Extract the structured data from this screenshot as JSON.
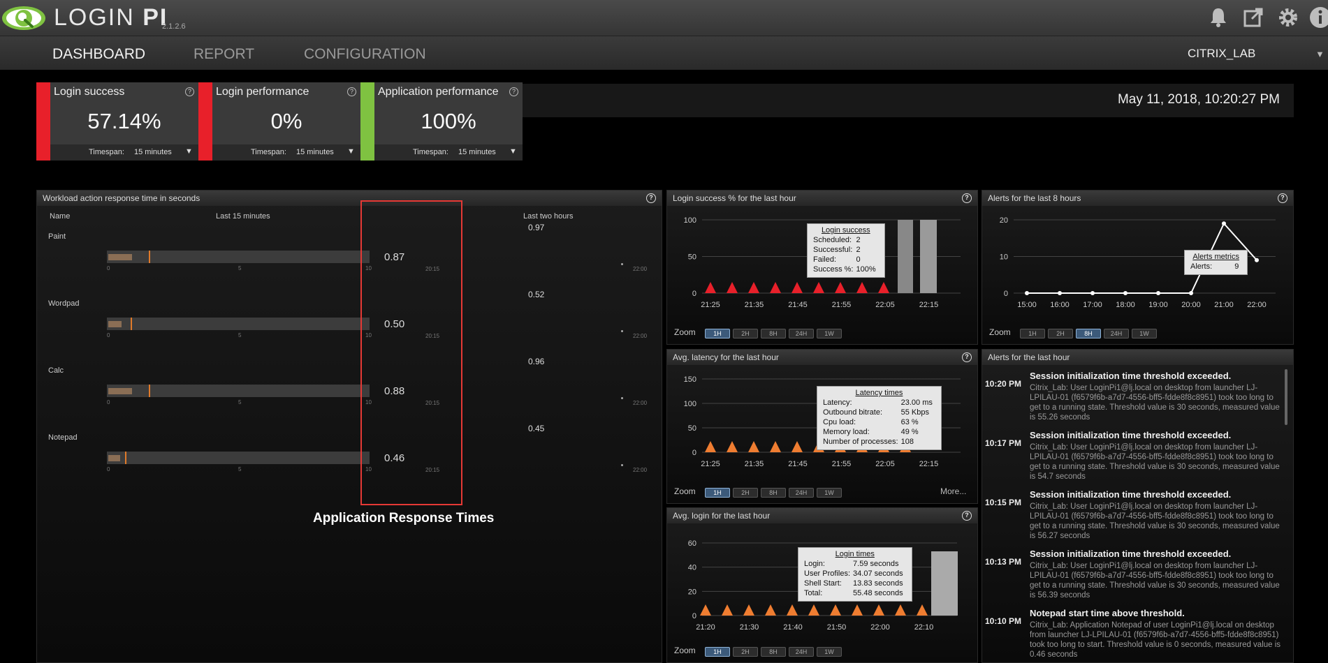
{
  "app": {
    "name_light": "LOGIN ",
    "name_bold": "PI",
    "version": "2.1.2.6"
  },
  "nav": {
    "tabs": [
      {
        "label": "DASHBOARD",
        "active": true
      },
      {
        "label": "REPORT",
        "active": false
      },
      {
        "label": "CONFIGURATION",
        "active": false
      }
    ],
    "environment": "CITRIX_LAB"
  },
  "kpis": [
    {
      "title": "Login success",
      "value": "57.14%",
      "status_color": "#e8202a",
      "timespan_label": "Timespan:",
      "timespan": "15 minutes"
    },
    {
      "title": "Login performance",
      "value": "0%",
      "status_color": "#e8202a",
      "timespan_label": "Timespan:",
      "timespan": "15 minutes"
    },
    {
      "title": "Application performance",
      "value": "100%",
      "status_color": "#7fc241",
      "timespan_label": "Timespan:",
      "timespan": "15 minutes"
    }
  ],
  "datetime": "May 11, 2018, 10:20:27 PM",
  "workload": {
    "title": "Workload action response time in seconds",
    "col_name": "Name",
    "col_last15": "Last 15 minutes",
    "col_last2h": "Last two hours",
    "axis_ticks": [
      "0",
      "5",
      "10"
    ],
    "bar_time": "20:15",
    "spark_time": "22:00",
    "rows": [
      {
        "name": "Paint",
        "value": "0.87",
        "fill_fraction": 0.09,
        "marker_fraction": 0.16,
        "two_hour_max": "0.97"
      },
      {
        "name": "Wordpad",
        "value": "0.50",
        "fill_fraction": 0.05,
        "marker_fraction": 0.09,
        "two_hour_max": "0.52"
      },
      {
        "name": "Calc",
        "value": "0.88",
        "fill_fraction": 0.09,
        "marker_fraction": 0.16,
        "two_hour_max": "0.96"
      },
      {
        "name": "Notepad",
        "value": "0.46",
        "fill_fraction": 0.045,
        "marker_fraction": 0.07,
        "two_hour_max": "0.45"
      }
    ],
    "annotation": "Application Response Times"
  },
  "zoom": {
    "label": "Zoom",
    "options": [
      "1H",
      "2H",
      "8H",
      "24H",
      "1W"
    ],
    "more": "More..."
  },
  "login_success_chart": {
    "title": "Login success % for the last hour",
    "tooltip": {
      "title": "Login success",
      "rows": [
        [
          "Scheduled:",
          "2"
        ],
        [
          "Successful:",
          "2"
        ],
        [
          "Failed:",
          "0"
        ],
        [
          "Success %:",
          "100%"
        ]
      ]
    },
    "selected_zoom": "1H"
  },
  "alerts_chart": {
    "title": "Alerts for the last 8 hours",
    "tooltip": {
      "title": "Alerts metrics",
      "rows": [
        [
          "Alerts:",
          "9"
        ]
      ]
    },
    "selected_zoom": "8H"
  },
  "latency_chart": {
    "title": "Avg. latency for the last hour",
    "tooltip": {
      "title": "Latency times",
      "rows": [
        [
          "Latency:",
          "23.00 ms"
        ],
        [
          "Outbound bitrate:",
          "55 Kbps"
        ],
        [
          "Cpu load:",
          "63 %"
        ],
        [
          "Memory load:",
          "49 %"
        ],
        [
          "Number of processes:",
          "108"
        ]
      ]
    },
    "selected_zoom": "1H"
  },
  "login_chart": {
    "title": "Avg. login for the last hour",
    "tooltip": {
      "title": "Login times",
      "rows": [
        [
          "Login:",
          "7.59 seconds"
        ],
        [
          "User Profiles:",
          "34.07 seconds"
        ],
        [
          "Shell Start:",
          "13.83 seconds"
        ],
        [
          "Total:",
          "55.48 seconds"
        ]
      ]
    },
    "selected_zoom": "1H"
  },
  "alerts_list": {
    "title": "Alerts for the last hour",
    "items": [
      {
        "time": "10:20 PM",
        "title": "Session initialization time threshold exceeded.",
        "body": "Citrix_Lab: User LoginPi1@lj.local on desktop from launcher LJ-LPILAU-01 (f6579f6b-a7d7-4556-bff5-fdde8f8c8951) took too long to get to a running state. Threshold value is 30 seconds, measured value is 55.26 seconds"
      },
      {
        "time": "10:17 PM",
        "title": "Session initialization time threshold exceeded.",
        "body": "Citrix_Lab: User LoginPi1@lj.local on desktop from launcher LJ-LPILAU-01 (f6579f6b-a7d7-4556-bff5-fdde8f8c8951) took too long to get to a running state. Threshold value is 30 seconds, measured value is 54.7 seconds"
      },
      {
        "time": "10:15 PM",
        "title": "Session initialization time threshold exceeded.",
        "body": "Citrix_Lab: User LoginPi1@lj.local on desktop from launcher LJ-LPILAU-01 (f6579f6b-a7d7-4556-bff5-fdde8f8c8951) took too long to get to a running state. Threshold value is 30 seconds, measured value is 56.27 seconds"
      },
      {
        "time": "10:13 PM",
        "title": "Session initialization time threshold exceeded.",
        "body": "Citrix_Lab: User LoginPi1@lj.local on desktop from launcher LJ-LPILAU-01 (f6579f6b-a7d7-4556-bff5-fdde8f8c8951) took too long to get to a running state. Threshold value is 30 seconds, measured value is 56.39 seconds"
      },
      {
        "time": "10:10 PM",
        "title": "Notepad start time above threshold.",
        "body": "Citrix_Lab: Application Notepad of user LoginPi1@lj.local on desktop from launcher LJ-LPILAU-01 (f6579f6b-a7d7-4556-bff5-fdde8f8c8951) took too long to start. Threshold value is 0 seconds, measured value is 0.46 seconds"
      }
    ]
  },
  "chart_data": [
    {
      "type": "area",
      "title": "Login success % for the last hour",
      "x": [
        "21:25",
        "21:35",
        "21:45",
        "21:55",
        "22:05",
        "22:15"
      ],
      "ylim": [
        0,
        100
      ],
      "yticks": [
        "0",
        "50",
        "100"
      ],
      "marker_count": 9,
      "series": [
        {
          "name": "Login success",
          "color": "#e8202a"
        }
      ]
    },
    {
      "type": "line",
      "title": "Alerts for the last 8 hours",
      "x": [
        "15:00",
        "16:00",
        "17:00",
        "18:00",
        "19:00",
        "20:00",
        "21:00",
        "22:00"
      ],
      "ylim": [
        0,
        20
      ],
      "yticks": [
        "0",
        "10",
        "20"
      ],
      "series": [
        {
          "name": "Alerts metrics",
          "values": [
            0,
            0,
            0,
            0,
            0,
            0,
            19,
            9
          ]
        }
      ]
    },
    {
      "type": "area",
      "title": "Avg. latency for the last hour",
      "x": [
        "21:25",
        "21:35",
        "21:45",
        "21:55",
        "22:05",
        "22:15"
      ],
      "ylim": [
        0,
        150
      ],
      "yticks": [
        "0",
        "50",
        "100",
        "150"
      ],
      "marker_count": 10,
      "series": [
        {
          "name": "Latency times",
          "color": "#ef7d31"
        }
      ]
    },
    {
      "type": "area",
      "title": "Avg. login for the last hour",
      "x": [
        "21:20",
        "21:30",
        "21:40",
        "21:50",
        "22:00",
        "22:10"
      ],
      "ylim": [
        0,
        60
      ],
      "yticks": [
        "0",
        "20",
        "40",
        "60"
      ],
      "marker_count": 11,
      "series": [
        {
          "name": "Login times",
          "color": "#ef7d31"
        }
      ]
    }
  ]
}
